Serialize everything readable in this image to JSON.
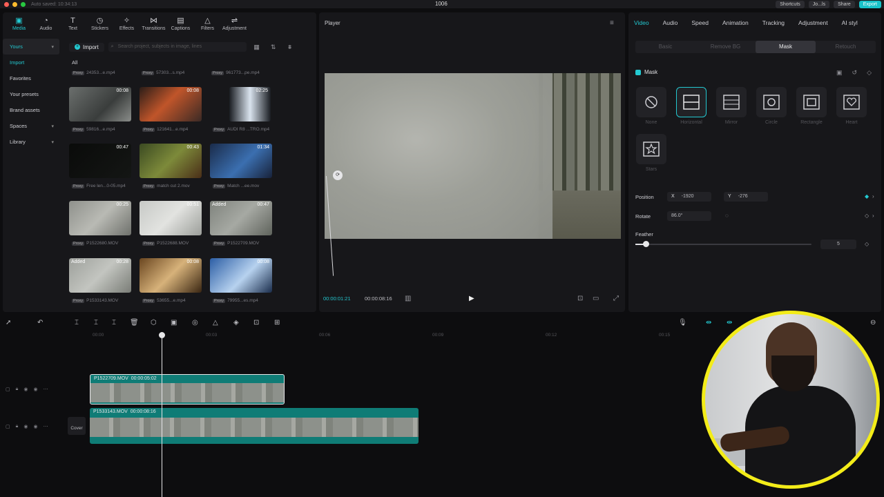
{
  "top": {
    "autosave": "Auto saved: 10:34:13",
    "project_title": "1006",
    "shortcuts": "Shortcuts",
    "user": "Jo...ls",
    "share": "Share",
    "export": "Export"
  },
  "toolbar": [
    {
      "label": "Media",
      "icon": "media-icon"
    },
    {
      "label": "Audio",
      "icon": "audio-icon"
    },
    {
      "label": "Text",
      "icon": "text-icon"
    },
    {
      "label": "Stickers",
      "icon": "stickers-icon"
    },
    {
      "label": "Effects",
      "icon": "effects-icon"
    },
    {
      "label": "Transitions",
      "icon": "transitions-icon"
    },
    {
      "label": "Captions",
      "icon": "captions-icon"
    },
    {
      "label": "Filters",
      "icon": "filters-icon"
    },
    {
      "label": "Adjustment",
      "icon": "adjustment-icon"
    }
  ],
  "sidebar": {
    "items": [
      "Yours",
      "Import",
      "Favorites",
      "Your presets",
      "Brand assets",
      "Spaces",
      "Library"
    ]
  },
  "media": {
    "import_label": "Import",
    "search_placeholder": "Search project, subjects in image, lines",
    "all_label": "All",
    "top_names": [
      "24353...e.mp4",
      "57303...s.mp4",
      "961773...pe.mp4"
    ],
    "items": [
      {
        "name": "59816...e.mp4",
        "duration": "00:08",
        "added": ""
      },
      {
        "name": "121641...e.mp4",
        "duration": "00:08",
        "added": ""
      },
      {
        "name": "AUDI R8 ...TRO.mp4",
        "duration": "02:25",
        "added": ""
      },
      {
        "name": "Free len...0-05.mp4",
        "duration": "00:47",
        "added": ""
      },
      {
        "name": "match cut 2.mov",
        "duration": "00:43",
        "added": ""
      },
      {
        "name": "Match ...ee.mov",
        "duration": "01:34",
        "added": ""
      },
      {
        "name": "P1522680.MOV",
        "duration": "00:25",
        "added": ""
      },
      {
        "name": "P1522688.MOV",
        "duration": "00:51",
        "added": ""
      },
      {
        "name": "P1522709.MOV",
        "duration": "00:47",
        "added": "Added"
      },
      {
        "name": "P1533143.MOV",
        "duration": "00:28",
        "added": "Added"
      },
      {
        "name": "53655...e.mp4",
        "duration": "00:08",
        "added": ""
      },
      {
        "name": "79955...es.mp4",
        "duration": "00:08",
        "added": ""
      }
    ]
  },
  "player": {
    "title": "Player",
    "current_time": "00:00:01:21",
    "total_time": "00:00:08:16"
  },
  "right": {
    "tabs": [
      "Video",
      "Audio",
      "Speed",
      "Animation",
      "Tracking",
      "Adjustment",
      "AI styl"
    ],
    "subtabs": [
      "Basic",
      "Remove BG",
      "Mask",
      "Retouch"
    ],
    "mask_label": "Mask",
    "mask_options": [
      "None",
      "Horizontal",
      "Mirror",
      "Circle",
      "Rectangle",
      "Heart",
      "Stars"
    ],
    "position_label": "Position",
    "pos_x_label": "X",
    "pos_x": "-1920",
    "pos_y_label": "Y",
    "pos_y": "-276",
    "rotate_label": "Rotate",
    "rotate": "86.0°",
    "feather_label": "Feather",
    "feather": "5",
    "feather_fraction": 0.06
  },
  "timeline": {
    "ruler": [
      "00:00",
      "00:03",
      "00:06",
      "00:09",
      "00:12",
      "00:15"
    ],
    "clips": [
      {
        "name": "P1522709.MOV",
        "duration": "00:00:05:02"
      },
      {
        "name": "P1533143.MOV",
        "duration": "00:00:08:16"
      }
    ],
    "cover_label": "Cover"
  },
  "colors": {
    "accent": "#23c9d1",
    "clip": "#0f7c76",
    "webcam_ring": "#f3ec18"
  }
}
